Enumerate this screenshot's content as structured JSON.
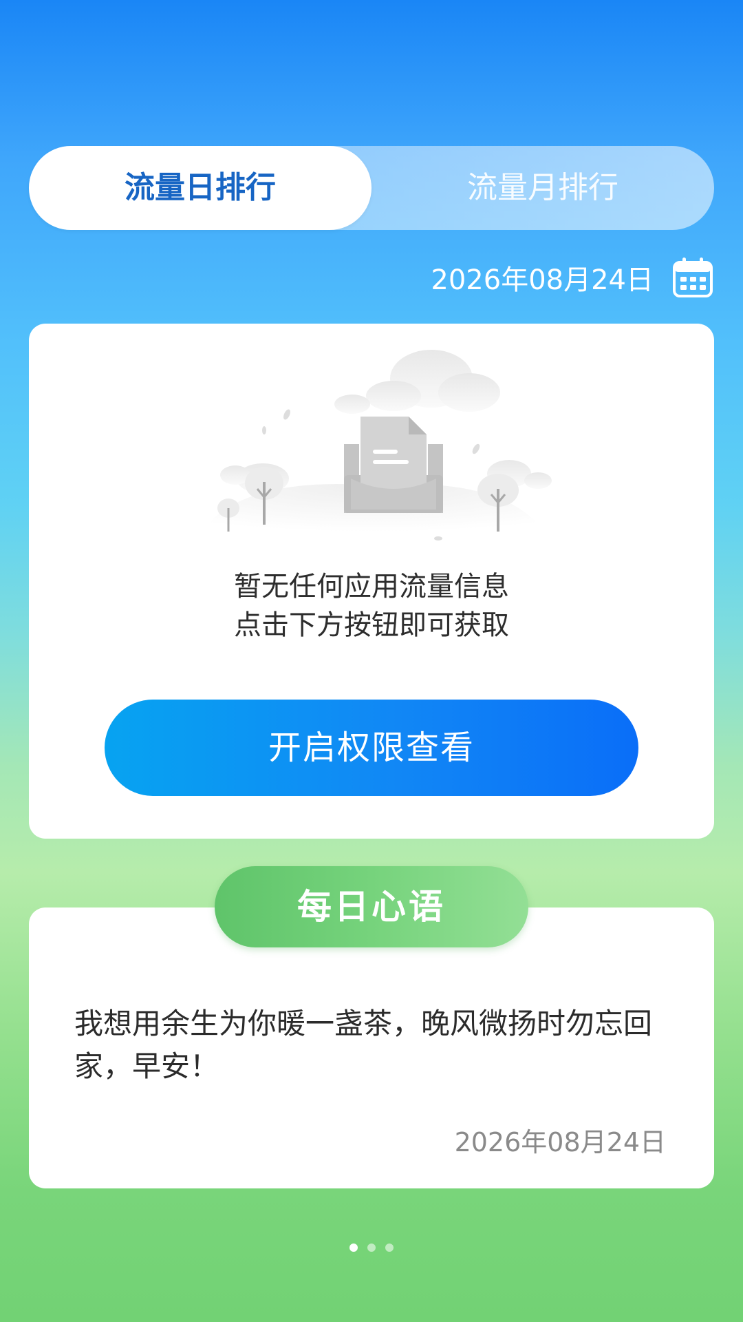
{
  "tabs": [
    {
      "label": "流量日排行",
      "active": true
    },
    {
      "label": "流量月排行",
      "active": false
    }
  ],
  "date": "2026年08月24日",
  "empty_state": {
    "line1": "暂无任何应用流量信息",
    "line2": "点击下方按钮即可获取"
  },
  "primary_button": {
    "label": "开启权限查看"
  },
  "daily_quote": {
    "title": "每日心语",
    "text": "我想用余生为你暖一盏茶，晚风微扬时勿忘回家，早安！",
    "date": "2026年08月24日"
  },
  "pager": {
    "total": 3,
    "current": 1
  },
  "colors": {
    "active_tab_text": "#1765c4",
    "button_blue": "#1187f5",
    "pill_green": "#76d37c"
  }
}
